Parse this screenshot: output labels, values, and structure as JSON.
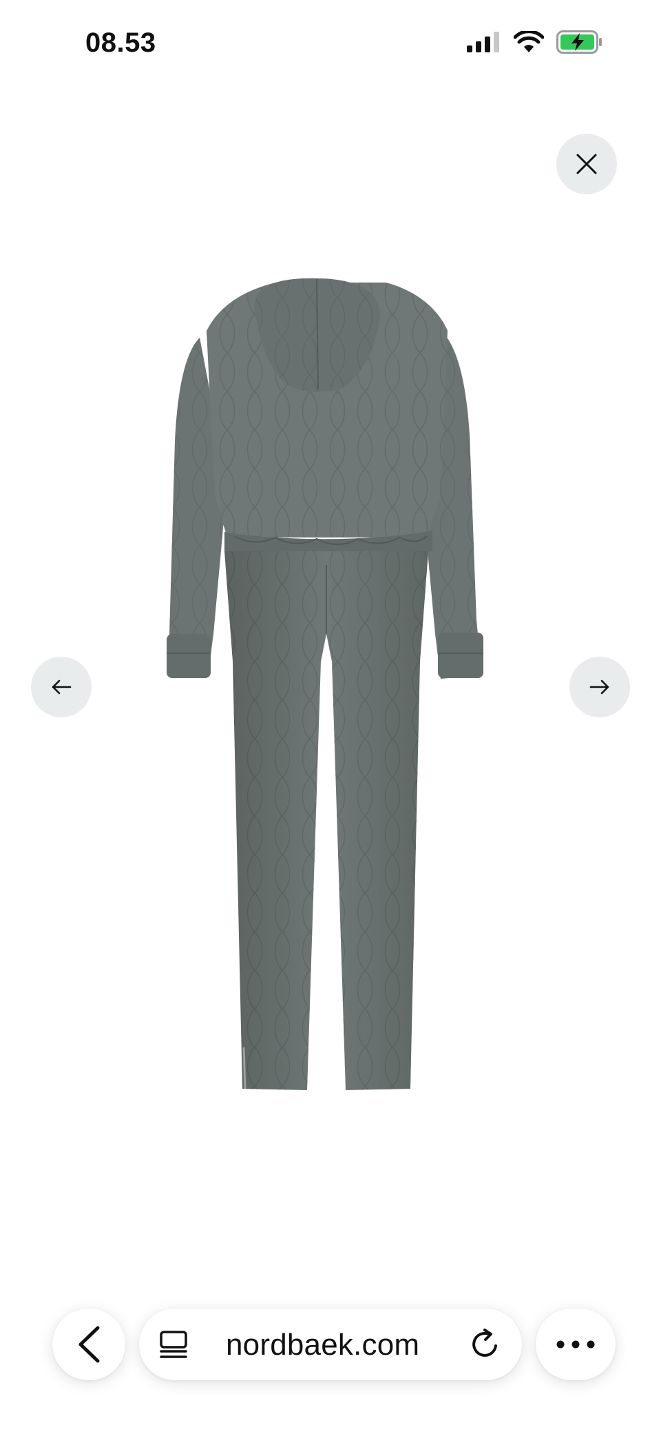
{
  "status_bar": {
    "time": "08.53",
    "signal_icon": "cellular-signal-icon",
    "wifi_icon": "wifi-icon",
    "battery_icon": "battery-charging-icon",
    "battery_color": "#34c759"
  },
  "lightbox": {
    "close_icon": "close-icon",
    "prev_icon": "arrow-left-icon",
    "next_icon": "arrow-right-icon",
    "button_bg": "#e8eced",
    "product_image": "quilted-jumpsuit-back-view",
    "product_color": "#6b7472"
  },
  "browser_bar": {
    "back_icon": "chevron-left-icon",
    "reader_icon": "reader-mode-icon",
    "url": "nordbaek.com",
    "reload_icon": "reload-icon",
    "more_icon": "more-dots-icon"
  }
}
